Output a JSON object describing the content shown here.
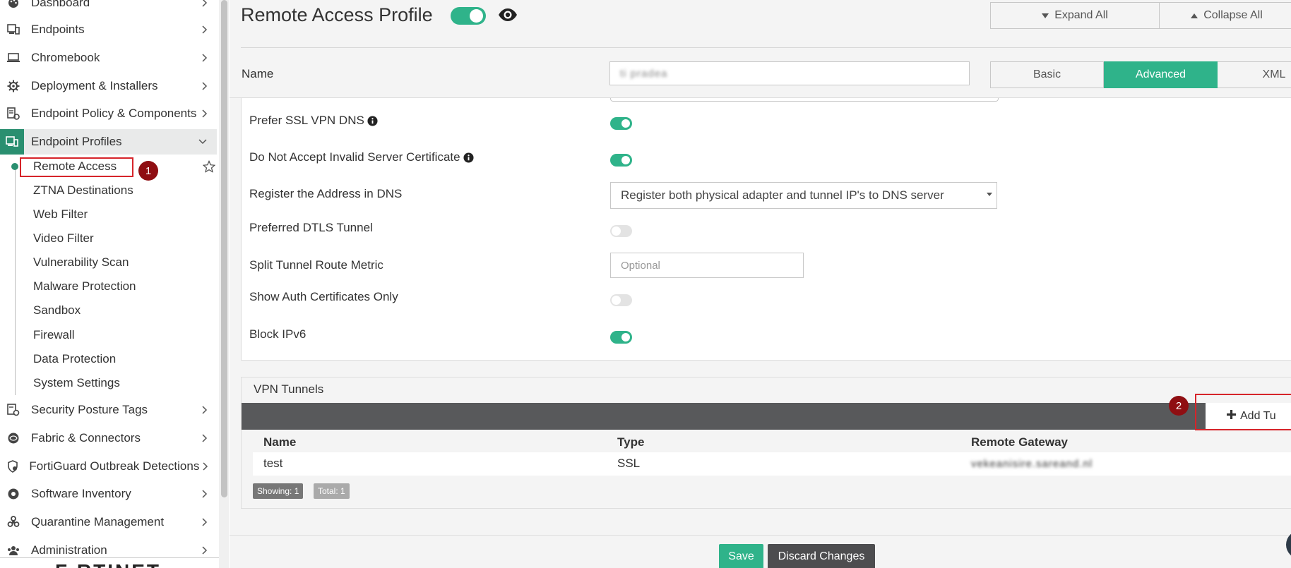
{
  "sidebar": {
    "items": [
      {
        "label": "Dashboard",
        "icon": "palette-icon"
      },
      {
        "label": "Endpoints",
        "icon": "endpoints-icon"
      },
      {
        "label": "Chromebook",
        "icon": "laptop-icon"
      },
      {
        "label": "Deployment & Installers",
        "icon": "gear-icon"
      },
      {
        "label": "Endpoint Policy & Components",
        "icon": "policy-icon"
      },
      {
        "label": "Endpoint Profiles",
        "icon": "profile-icon"
      }
    ],
    "sub_items": [
      {
        "label": "Remote Access"
      },
      {
        "label": "ZTNA Destinations"
      },
      {
        "label": "Web Filter"
      },
      {
        "label": "Video Filter"
      },
      {
        "label": "Vulnerability Scan"
      },
      {
        "label": "Malware Protection"
      },
      {
        "label": "Sandbox"
      },
      {
        "label": "Firewall"
      },
      {
        "label": "Data Protection"
      },
      {
        "label": "System Settings"
      }
    ],
    "bottom_items": [
      {
        "label": "Security Posture Tags",
        "icon": "tag-icon"
      },
      {
        "label": "Fabric & Connectors",
        "icon": "fabric-icon"
      },
      {
        "label": "FortiGuard Outbreak Detections",
        "icon": "outbreak-icon"
      },
      {
        "label": "Software Inventory",
        "icon": "inventory-icon"
      },
      {
        "label": "Quarantine Management",
        "icon": "biohazard-icon"
      },
      {
        "label": "Administration",
        "icon": "users-icon"
      }
    ],
    "logo": "F RTINET"
  },
  "annotations": {
    "badge1": "1",
    "badge2": "2"
  },
  "header": {
    "title": "Remote Access Profile",
    "expand_all": "Expand All",
    "collapse_all": "Collapse All"
  },
  "name_field": {
    "label": "Name",
    "value": "ti pradea"
  },
  "view_tabs": {
    "basic": "Basic",
    "advanced": "Advanced",
    "xml": "XML",
    "active": "Advanced"
  },
  "settings": {
    "prefer_ssl_vpn_dns": {
      "label": "Prefer SSL VPN DNS",
      "enabled": true
    },
    "do_not_accept_invalid_cert": {
      "label": "Do Not Accept Invalid Server Certificate",
      "enabled": true
    },
    "register_address_dns": {
      "label": "Register the Address in DNS",
      "value": "Register both physical adapter and tunnel IP's to DNS server"
    },
    "preferred_dtls_tunnel": {
      "label": "Preferred DTLS Tunnel",
      "enabled": false
    },
    "split_tunnel_route_metric": {
      "label": "Split Tunnel Route Metric",
      "placeholder": "Optional"
    },
    "show_auth_certificates_only": {
      "label": "Show Auth Certificates Only",
      "enabled": false
    },
    "block_ipv6": {
      "label": "Block IPv6",
      "enabled": true
    }
  },
  "vpn_tunnels": {
    "title": "VPN Tunnels",
    "add_button": "Add Tu",
    "columns": [
      "Name",
      "Type",
      "Remote Gateway"
    ],
    "rows": [
      {
        "name": "test",
        "type": "SSL",
        "remote_gateway": "vekeanisire.sareand.nl"
      }
    ],
    "showing": "Showing: 1",
    "total": "Total: 1"
  },
  "footer": {
    "save": "Save",
    "discard": "Discard Changes"
  },
  "colors": {
    "accent": "#2fb38a",
    "sidebar_active": "#2a8f70",
    "annotation_red": "#d6242a",
    "badge": "#8f0e12",
    "toolbar": "#58595b"
  }
}
